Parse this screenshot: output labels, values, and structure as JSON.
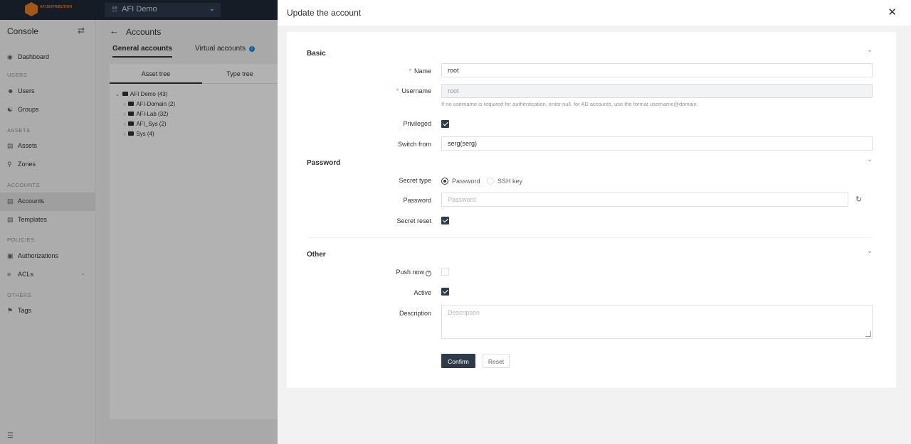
{
  "topbar": {
    "logo_text": "AFI DISTRIBUTION",
    "org_select": "AFI Demo"
  },
  "sidebar": {
    "title": "Console",
    "sections": {
      "users": "USERS",
      "assets": "ASSETS",
      "accounts": "ACCOUNTS",
      "policies": "POLICIES",
      "others": "OTHERS"
    },
    "items": {
      "dashboard": "Dashboard",
      "users": "Users",
      "groups": "Groups",
      "assets": "Assets",
      "zones": "Zones",
      "accounts": "Accounts",
      "templates": "Templates",
      "authorizations": "Authorizations",
      "acls": "ACLs",
      "tags": "Tags"
    },
    "active_item": "Accounts"
  },
  "main": {
    "title": "Accounts",
    "tabs": {
      "general": "General accounts",
      "virtual": "Virtual accounts"
    },
    "tree_tabs": {
      "asset": "Asset tree",
      "type": "Type tree"
    },
    "tree": {
      "root": "AFI Demo (43)",
      "children": [
        "AFI-Domain (2)",
        "AFI-Lab (32)",
        "AFI_Sys (2)",
        "Sys (4)"
      ]
    }
  },
  "drawer": {
    "title": "Update the account",
    "sections": {
      "basic": "Basic",
      "password": "Password",
      "other": "Other"
    },
    "fields": {
      "name": {
        "label": "Name",
        "value": "root",
        "required": true
      },
      "username": {
        "label": "Username",
        "value": "root",
        "required": true,
        "hint": "If no username is required for authentication, enter null. for AD accounts, use the format username@domain."
      },
      "privileged": {
        "label": "Privileged",
        "checked": true
      },
      "switch_from": {
        "label": "Switch from",
        "value": "serg(serg)"
      },
      "secret_type": {
        "label": "Secret type",
        "options": [
          "Password",
          "SSH key"
        ],
        "selected": "Password"
      },
      "password": {
        "label": "Password",
        "placeholder": "Password"
      },
      "secret_reset": {
        "label": "Secret reset",
        "checked": true
      },
      "push_now": {
        "label": "Push now",
        "checked": false
      },
      "active": {
        "label": "Active",
        "checked": true
      },
      "description": {
        "label": "Description",
        "placeholder": "Description"
      }
    },
    "buttons": {
      "confirm": "Confirm",
      "reset": "Reset"
    }
  },
  "colors": {
    "primary": "#303b49",
    "topbar": "#1f2937",
    "brand": "#e67e22",
    "required": "#f56c6c",
    "info": "#1e88e5"
  }
}
